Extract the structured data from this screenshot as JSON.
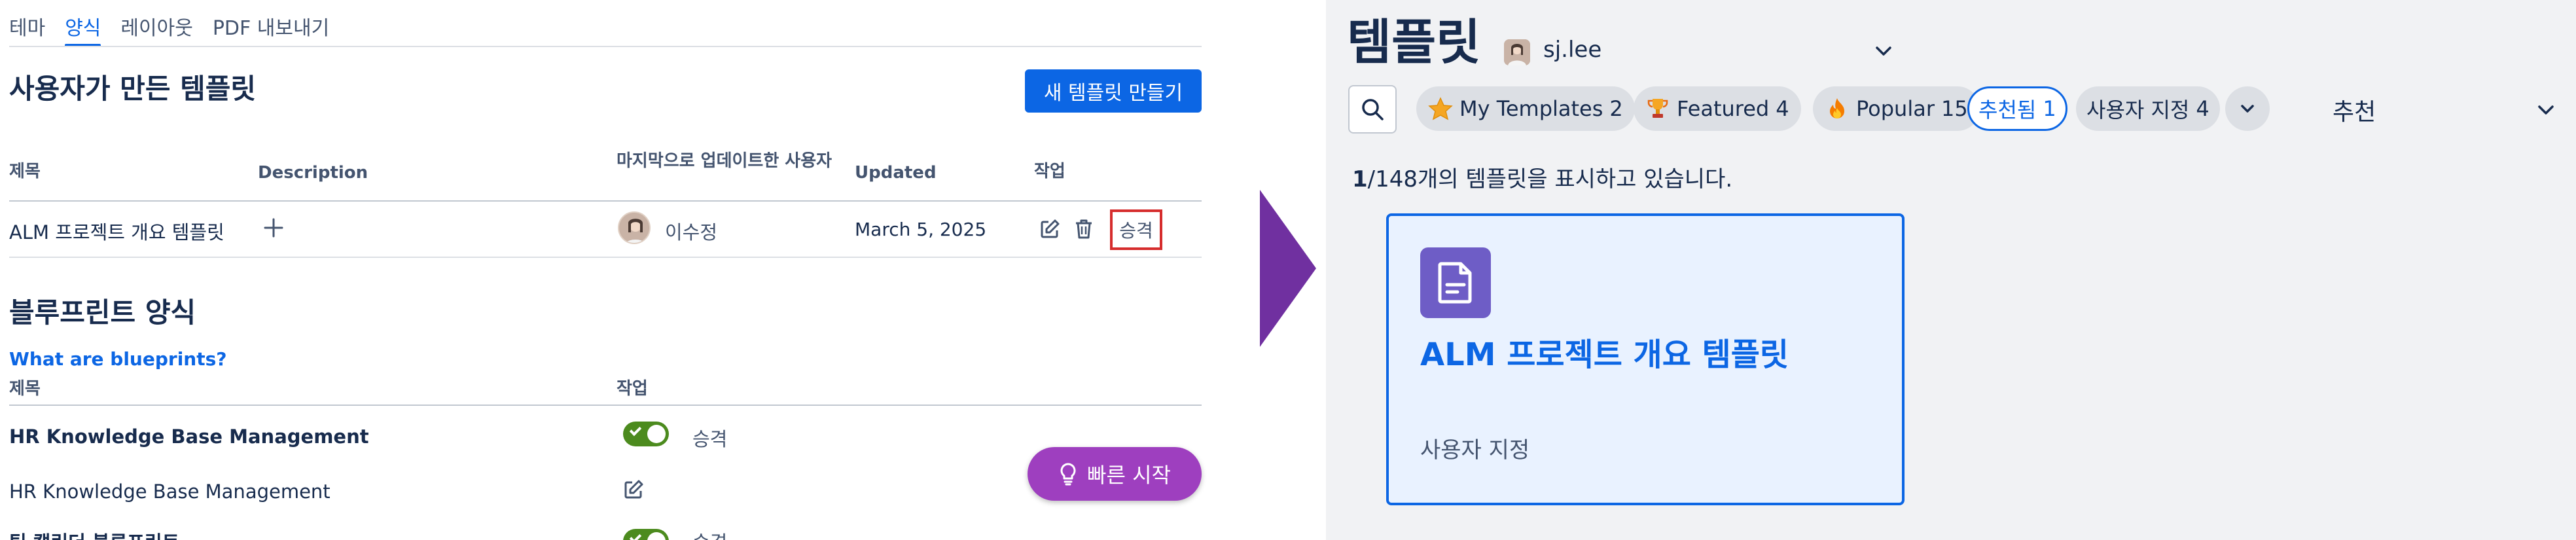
{
  "left": {
    "tabs": [
      {
        "label": "테마",
        "active": false
      },
      {
        "label": "양식",
        "active": true
      },
      {
        "label": "레이아웃",
        "active": false
      },
      {
        "label": "PDF 내보내기",
        "active": false
      }
    ],
    "user_templates": {
      "title": "사용자가 만든 템플릿",
      "create_button": "새 템플릿 만들기",
      "columns": {
        "title": "제목",
        "description": "Description",
        "updated_by": "마지막으로 업데이트한 사용자",
        "updated": "Updated",
        "actions": "작업"
      },
      "rows": [
        {
          "title": "ALM 프로젝트 개요 템플릿",
          "updated_by": "이수정",
          "updated": "March 5, 2025",
          "approve_label": "승격"
        }
      ]
    },
    "blueprints": {
      "title": "블루프린트 양식",
      "help_link": "What are blueprints?",
      "columns": {
        "title": "제목",
        "actions": "작업"
      },
      "rows": [
        {
          "title": "HR Knowledge Base Management",
          "bold": true,
          "status": "승격"
        },
        {
          "title": "HR Knowledge Base Management",
          "bold": false
        },
        {
          "title": "팀 캘린더 블루프린트",
          "bold": true,
          "status": "승격"
        }
      ]
    },
    "quick_start": "빠른 시작"
  },
  "right": {
    "title": "템플릿",
    "user": "sj.lee",
    "filters": [
      {
        "label": "My Templates",
        "count": "2",
        "icon": "star-icon",
        "selected": false
      },
      {
        "label": "Featured",
        "count": "4",
        "icon": "trophy-icon",
        "selected": false
      },
      {
        "label": "Popular",
        "count": "15",
        "icon": "fire-icon",
        "selected": false
      },
      {
        "label": "추천됨",
        "count": "1",
        "icon": "",
        "selected": true
      },
      {
        "label": "사용자 지정",
        "count": "4",
        "icon": "",
        "selected": false
      }
    ],
    "sort": "추천",
    "showing": {
      "count": "1",
      "rest": "/148개의 템플릿을 표시하고 있습니다."
    },
    "card": {
      "title": "ALM 프로젝트 개요 템플릿",
      "subtitle": "사용자 지정"
    }
  },
  "colors": {
    "primary": "#0c66e4",
    "purple_button": "#9e3fbf",
    "arrow": "#7030a0",
    "toggle_on": "#4c8b1e",
    "highlight_box": "#d62d2d",
    "card_icon": "#6e5dc6"
  }
}
